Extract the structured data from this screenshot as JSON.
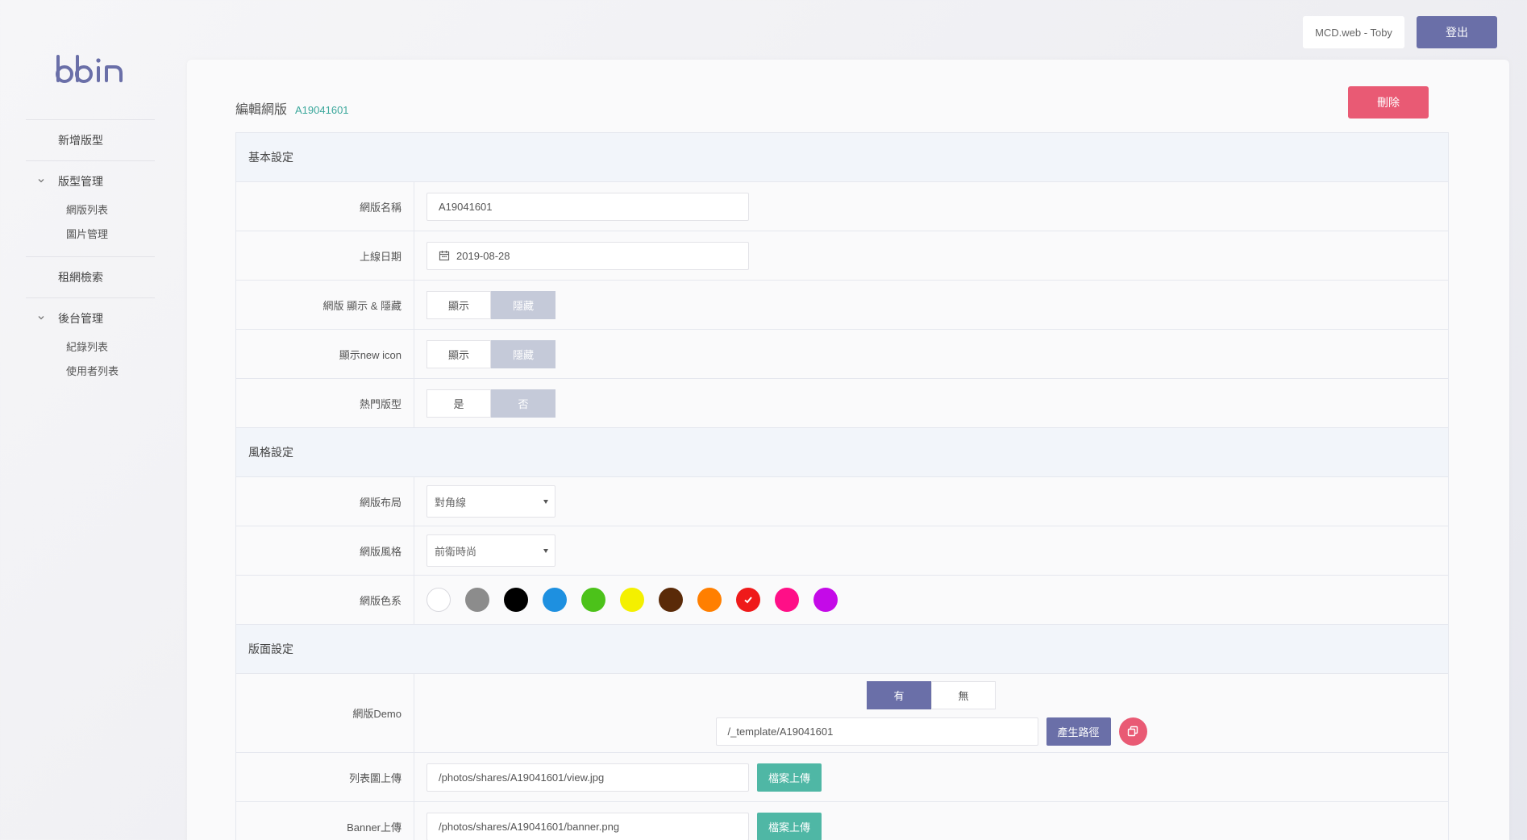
{
  "brand": {
    "logo_text": "bbin"
  },
  "sidebar": {
    "items": [
      {
        "label": "新增版型"
      },
      {
        "label": "版型管理",
        "children": [
          {
            "label": "網版列表"
          },
          {
            "label": "圖片管理"
          }
        ]
      },
      {
        "label": "租網檢索"
      },
      {
        "label": "後台管理",
        "children": [
          {
            "label": "紀錄列表"
          },
          {
            "label": "使用者列表"
          }
        ]
      }
    ]
  },
  "header": {
    "user": "MCD.web - Toby",
    "logout_label": "登出"
  },
  "page": {
    "title": "編輯網版",
    "code": "A19041601",
    "delete_label": "刪除"
  },
  "sections": {
    "basic": "基本設定",
    "style": "風格設定",
    "layout": "版面設定"
  },
  "fields": {
    "name": {
      "label": "網版名稱",
      "value": "A19041601"
    },
    "date": {
      "label": "上線日期",
      "value": "2019-08-28"
    },
    "visibility": {
      "label": "網版 顯示 & 隱藏",
      "options": [
        "顯示",
        "隱藏"
      ],
      "selected": "隱藏"
    },
    "new_icon": {
      "label": "顯示new icon",
      "options": [
        "顯示",
        "隱藏"
      ],
      "selected": "隱藏"
    },
    "hot": {
      "label": "熱門版型",
      "options": [
        "是",
        "否"
      ],
      "selected": "否"
    },
    "layout": {
      "label": "網版布局",
      "value": "對角線"
    },
    "style": {
      "label": "網版風格",
      "value": "前衛時尚"
    },
    "colors": {
      "label": "網版色系",
      "palette": [
        "#ffffff",
        "#8c8c8c",
        "#000000",
        "#1e90e0",
        "#4cc21a",
        "#f4f000",
        "#5a2a08",
        "#ff7f00",
        "#ef1a1a",
        "#ff0f87",
        "#c40ae8"
      ],
      "selected_index": 8
    },
    "demo": {
      "label": "網版Demo",
      "options": [
        "有",
        "無"
      ],
      "selected": "有",
      "path": "/_template/A19041601",
      "generate_label": "產生路徑"
    },
    "list_image": {
      "label": "列表圖上傳",
      "value": "/photos/shares/A19041601/view.jpg",
      "upload_label": "檔案上傳"
    },
    "banner": {
      "label": "Banner上傳",
      "value": "/photos/shares/A19041601/banner.png",
      "upload_label": "檔案上傳"
    }
  }
}
